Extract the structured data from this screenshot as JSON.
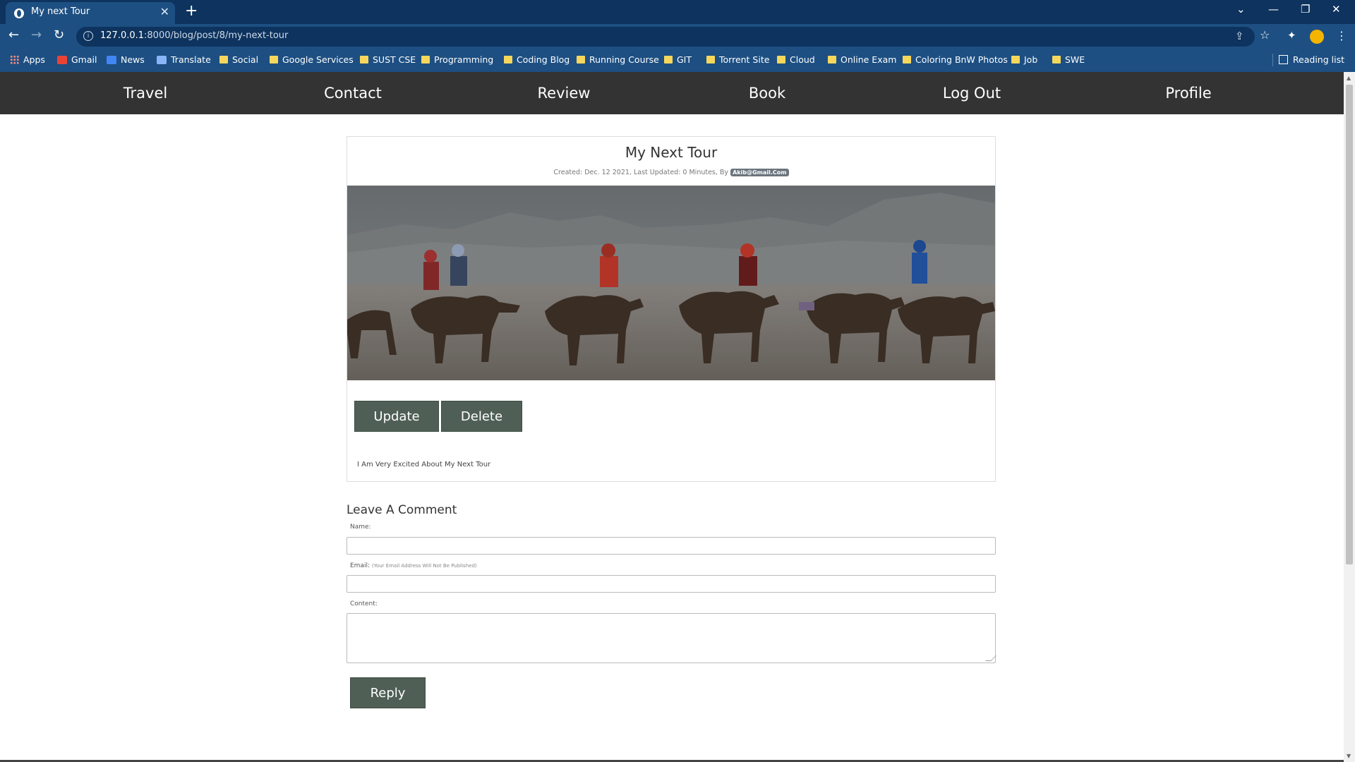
{
  "browser": {
    "tab_title": "My next Tour",
    "url_host": "127.0.0.1",
    "url_rest": ":8000/blog/post/8/my-next-tour",
    "bookmarks": [
      {
        "label": "Apps",
        "icon": "apps-grid-icon"
      },
      {
        "label": "Gmail",
        "icon": "gmail-icon"
      },
      {
        "label": "News",
        "icon": "news-icon"
      },
      {
        "label": "Translate",
        "icon": "translate-icon"
      },
      {
        "label": "Social",
        "icon": "folder-icon"
      },
      {
        "label": "Google Services",
        "icon": "folder-icon"
      },
      {
        "label": "SUST CSE",
        "icon": "folder-icon"
      },
      {
        "label": "Programming",
        "icon": "folder-icon"
      },
      {
        "label": "Coding Blog",
        "icon": "folder-icon"
      },
      {
        "label": "Running Course",
        "icon": "folder-icon"
      },
      {
        "label": "GIT",
        "icon": "folder-icon"
      },
      {
        "label": "Torrent Site",
        "icon": "folder-icon"
      },
      {
        "label": "Cloud",
        "icon": "folder-icon"
      },
      {
        "label": "Online Exam",
        "icon": "folder-icon"
      },
      {
        "label": "Coloring BnW Photos",
        "icon": "folder-icon"
      },
      {
        "label": "Job",
        "icon": "folder-icon"
      },
      {
        "label": "SWE",
        "icon": "folder-icon"
      }
    ],
    "reading_list": "Reading list"
  },
  "nav": {
    "items": [
      "Travel",
      "Contact",
      "Review",
      "Book",
      "Log Out",
      "Profile"
    ]
  },
  "post": {
    "title": "My Next Tour",
    "meta_prefix": "Created: Dec. 12 2021, Last Updated: 0 Minutes, By",
    "author": "Akib@Gmail.Com",
    "image_alt": "camel caravan in desert",
    "update_label": "Update",
    "delete_label": "Delete",
    "body": "I Am Very Excited About My Next Tour"
  },
  "comment_form": {
    "title": "Leave A Comment",
    "name_label": "Name:",
    "email_label": "Email:",
    "email_hint": "(Your Email Address Will Not Be Published)",
    "content_label": "Content:",
    "reply_label": "Reply"
  },
  "colors": {
    "tab_bar": "#0d335e",
    "toolbar": "#1d4f82",
    "navbar": "#333333",
    "button": "#4f5f56"
  }
}
